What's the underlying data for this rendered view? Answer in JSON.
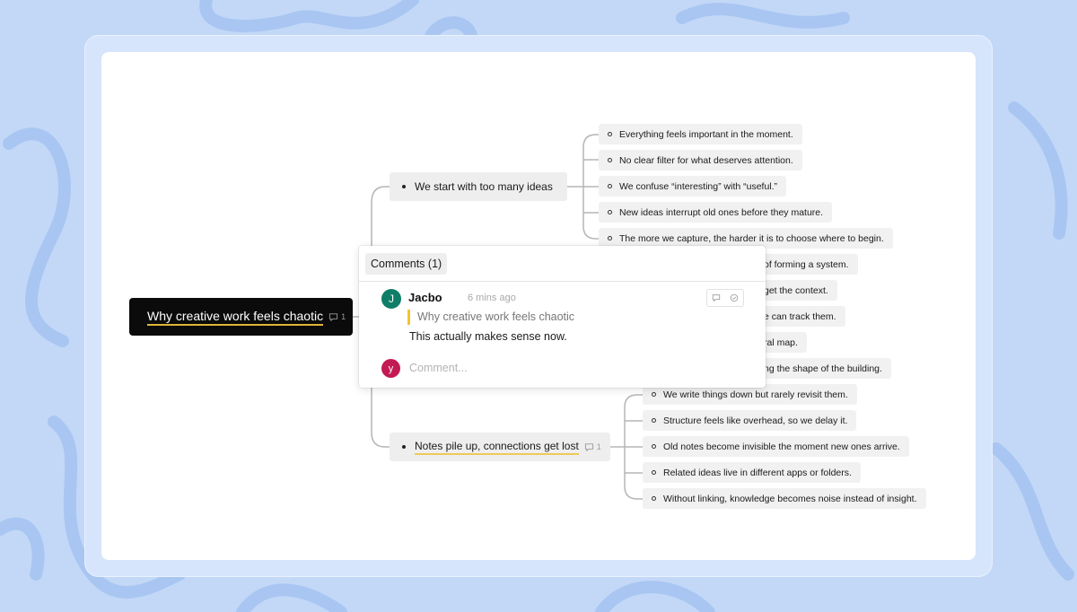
{
  "colors": {
    "background": "#c3d8f7",
    "root_node": "#0b0b0b",
    "highlight": "#f0c95a",
    "author_avatar": "#0f7d67",
    "user_avatar": "#c21a52"
  },
  "mindmap": {
    "root": {
      "label": "Why creative work feels chaotic",
      "comment_count": "1"
    },
    "branches": [
      {
        "label": "We start with too many ideas",
        "children": [
          "Everything feels important in the moment.",
          "No clear filter for what deserves attention.",
          "We confuse “interesting” with “useful.”",
          "New ideas interrupt old ones before they mature.",
          "The more we capture, the harder it is to choose where to begin."
        ]
      },
      {
        "label": "",
        "children": [
          "of forming a system.",
          "get the context.",
          "e can track them.",
          "ral map.",
          "ng the shape of the building."
        ]
      },
      {
        "label": "Notes pile up, connections get lost",
        "comment_count": "1",
        "children": [
          "We write things down but rarely revisit them.",
          "Structure feels like overhead, so we delay it.",
          "Old notes become invisible the moment new ones arrive.",
          "Related ideas live in different apps or folders.",
          "Without linking, knowledge becomes noise instead of insight."
        ]
      }
    ]
  },
  "comments": {
    "title": "Comments (1)",
    "items": [
      {
        "avatar_letter": "J",
        "author": "Jacbo",
        "time": "6 mins ago",
        "quote": "Why creative work feels chaotic",
        "body": "This actually makes sense now."
      }
    ],
    "input": {
      "avatar_letter": "y",
      "placeholder": "Comment..."
    }
  }
}
